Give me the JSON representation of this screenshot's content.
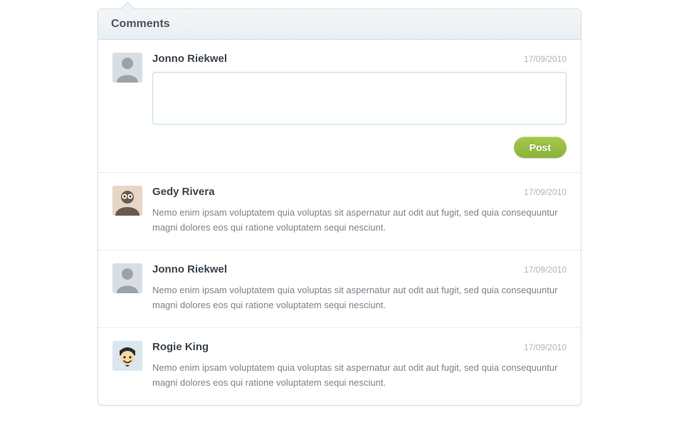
{
  "panel": {
    "title": "Comments"
  },
  "compose": {
    "author": "Jonno Riekwel",
    "date": "17/09/2010",
    "value": "",
    "post_label": "Post"
  },
  "comments": [
    {
      "author": "Gedy Rivera",
      "date": "17/09/2010",
      "text": "Nemo enim ipsam voluptatem quia voluptas sit aspernatur aut odit aut fugit, sed quia consequuntur magni dolores eos qui ratione voluptatem sequi nesciunt."
    },
    {
      "author": "Jonno Riekwel",
      "date": "17/09/2010",
      "text": "Nemo enim ipsam voluptatem quia voluptas sit aspernatur aut odit aut fugit, sed quia consequuntur magni dolores eos qui ratione voluptatem sequi nesciunt."
    },
    {
      "author": "Rogie King",
      "date": "17/09/2010",
      "text": "Nemo enim ipsam voluptatem quia voluptas sit aspernatur aut odit aut fugit, sed quia consequuntur magni dolores eos qui ratione voluptatem sequi nesciunt."
    }
  ]
}
